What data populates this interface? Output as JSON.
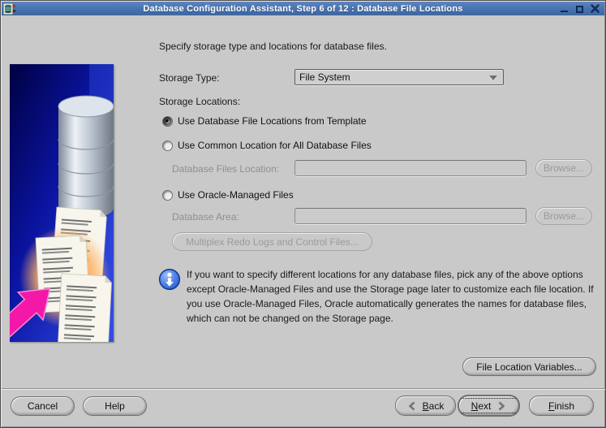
{
  "titlebar": {
    "title": "Database Configuration Assistant, Step 6 of 12 : Database File Locations"
  },
  "content": {
    "instruction": "Specify storage type and locations for database files.",
    "storage_type_label": "Storage Type:",
    "storage_type_value": "File System",
    "storage_locations_label": "Storage Locations:",
    "option_template_label": "Use Database File Locations from Template",
    "option_common_label": "Use Common Location for All Database Files",
    "option_omf_label": "Use Oracle-Managed Files",
    "selected_option": "Use Database File Locations from Template",
    "db_files_location_label": "Database Files Location:",
    "db_files_location_value": "",
    "db_area_label": "Database Area:",
    "db_area_value": "",
    "browse_label": "Browse...",
    "multiplex_label": "Multiplex Redo Logs and Control Files...",
    "info_text": "If you want to specify different locations for any database files, pick any of the above options except Oracle-Managed Files and use the Storage page later to customize each file location. If you use Oracle-Managed Files, Oracle automatically generates the names for database files, which can not be changed on the Storage page.",
    "file_location_variables_label": "File Location Variables..."
  },
  "footer": {
    "cancel": "Cancel",
    "help": "Help",
    "back_mnemonic": "B",
    "back_rest": "ack",
    "next_mnemonic": "N",
    "next_rest": "ext",
    "finish_mnemonic": "F",
    "finish_rest": "inish"
  },
  "colors": {
    "titlebar_blue": "#4a75b2",
    "window_bg": "#c9c9c9",
    "disabled_text": "#8f8f8f",
    "info_icon_blue": "#4d7fe8",
    "art_background_blue": "#0b1bb0",
    "art_arrow_pink": "#f318a8"
  }
}
